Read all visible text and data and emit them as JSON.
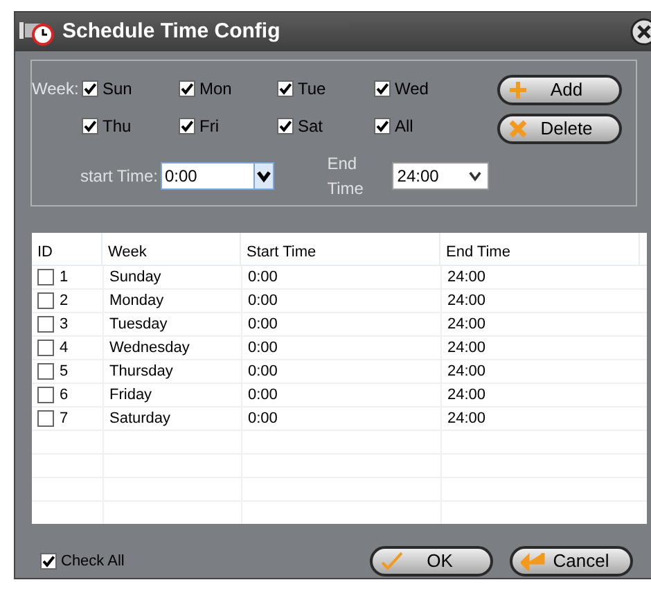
{
  "window": {
    "title": "Schedule Time Config"
  },
  "week_label": "Week:",
  "days": [
    {
      "label": "Sun",
      "checked": true
    },
    {
      "label": "Mon",
      "checked": true
    },
    {
      "label": "Tue",
      "checked": true
    },
    {
      "label": "Wed",
      "checked": true
    },
    {
      "label": "Thu",
      "checked": true
    },
    {
      "label": "Fri",
      "checked": true
    },
    {
      "label": "Sat",
      "checked": true
    },
    {
      "label": "All",
      "checked": true
    }
  ],
  "start_time": {
    "label": "start Time:",
    "value": "0:00"
  },
  "end_time": {
    "label": "End Time",
    "value": "24:00"
  },
  "side_buttons": [
    {
      "kind": "add",
      "label": "Add"
    },
    {
      "kind": "delete",
      "label": "Delete"
    }
  ],
  "table": {
    "columns": [
      "ID",
      "Week",
      "Start Time",
      "End Time"
    ],
    "rows": [
      {
        "id": "1",
        "week": "Sunday",
        "start": "0:00",
        "end": "24:00",
        "checked": false
      },
      {
        "id": "2",
        "week": "Monday",
        "start": "0:00",
        "end": "24:00",
        "checked": false
      },
      {
        "id": "3",
        "week": "Tuesday",
        "start": "0:00",
        "end": "24:00",
        "checked": false
      },
      {
        "id": "4",
        "week": "Wednesday",
        "start": "0:00",
        "end": "24:00",
        "checked": false
      },
      {
        "id": "5",
        "week": "Thursday",
        "start": "0:00",
        "end": "24:00",
        "checked": false
      },
      {
        "id": "6",
        "week": "Friday",
        "start": "0:00",
        "end": "24:00",
        "checked": false
      },
      {
        "id": "7",
        "week": "Saturday",
        "start": "0:00",
        "end": "24:00",
        "checked": false
      }
    ]
  },
  "check_all": {
    "label": "Check All",
    "checked": true
  },
  "bottom_buttons": [
    {
      "kind": "ok",
      "label": "OK"
    },
    {
      "kind": "cancel",
      "label": "Cancel"
    }
  ]
}
